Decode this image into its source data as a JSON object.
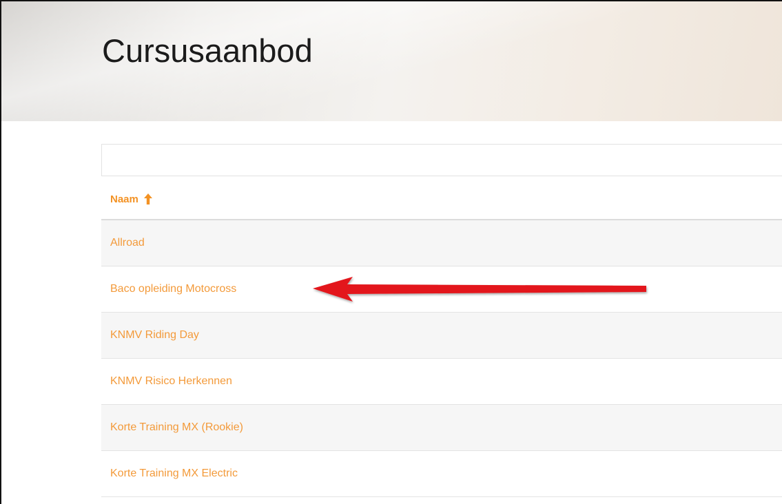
{
  "page": {
    "title": "Cursusaanbod"
  },
  "search": {
    "value": "",
    "placeholder": ""
  },
  "table": {
    "column_header": "Naam",
    "sort_icon": "arrow-up-icon",
    "rows": [
      {
        "label": "Allroad"
      },
      {
        "label": "Baco opleiding Motocross"
      },
      {
        "label": "KNMV Riding Day"
      },
      {
        "label": "KNMV Risico Herkennen"
      },
      {
        "label": "Korte Training MX (Rookie)"
      },
      {
        "label": "Korte Training MX Electric"
      }
    ]
  },
  "annotation": {
    "type": "red-arrow-icon",
    "points_to": "Baco opleiding Motocross"
  },
  "colors": {
    "accent": "#f39224",
    "link": "#f39a3a",
    "row_alt": "#f6f6f6",
    "annotation": "#e3161a"
  }
}
